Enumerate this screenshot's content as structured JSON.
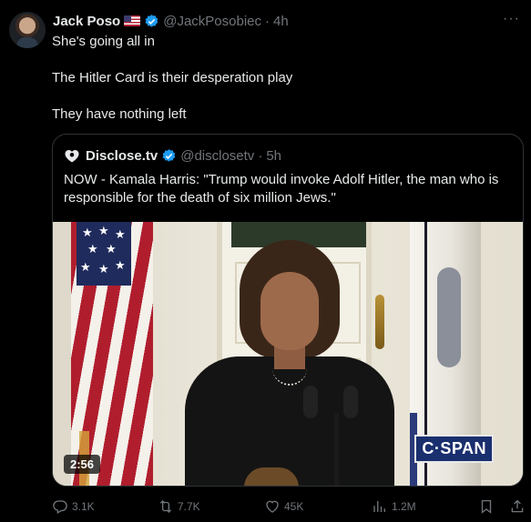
{
  "post": {
    "author_name": "Jack Poso",
    "handle": "@JackPosobiec",
    "separator": "·",
    "time": "4h",
    "more": "···",
    "lines": [
      "She's going all in",
      "The Hitler Card is their desperation play",
      "They have nothing left"
    ]
  },
  "quoted": {
    "author_name": "Disclose.tv",
    "handle": "@disclosetv",
    "separator": "·",
    "time": "5h",
    "text": "NOW - Kamala Harris: \"Trump would invoke Adolf Hitler, the man who is responsible for the death of six million Jews.\"",
    "video_duration": "2:56",
    "watermark": "C·SPAN"
  },
  "actions": {
    "replies": "3.1K",
    "reposts": "7.7K",
    "likes": "45K",
    "views": "1.2M"
  },
  "icons": {
    "verified": "verified-badge-icon",
    "flag": "us-flag-icon",
    "reply": "reply-icon",
    "repost": "repost-icon",
    "like": "heart-icon",
    "views": "views-icon",
    "bookmark": "bookmark-icon",
    "share": "share-icon"
  },
  "colors": {
    "background": "#000000",
    "text": "#e7e9ea",
    "muted": "#71767b",
    "verified": "#1d9bf0",
    "border": "#2f3336"
  }
}
